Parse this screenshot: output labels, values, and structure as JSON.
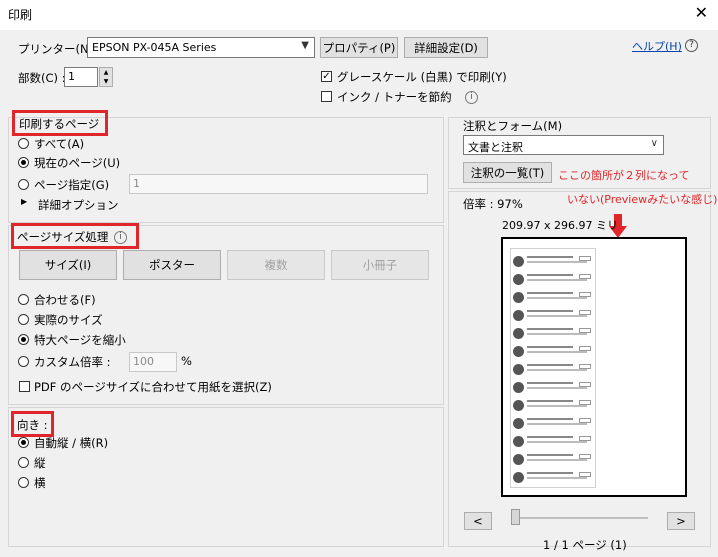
{
  "window": {
    "title": "印刷",
    "close_glyph": "✕"
  },
  "printer": {
    "label": "プリンター(N) :",
    "selected": "EPSON PX-045A Series",
    "properties_button": "プロパティ(P)",
    "advanced_button": "詳細設定(D)",
    "help_link": "ヘルプ(H)"
  },
  "copies": {
    "label": "部数(C) :",
    "value": "1"
  },
  "options": {
    "grayscale": "グレースケール (白黒) で印刷(Y)",
    "save_ink": "インク / トナーを節約"
  },
  "pages_section": {
    "title": "印刷するページ",
    "all": "すべて(A)",
    "current": "現在のページ(U)",
    "range": "ページ指定(G)",
    "range_value": "1",
    "more_options": "詳細オプション"
  },
  "size_section": {
    "title": "ページサイズ処理",
    "tabs": [
      "サイズ(I)",
      "ポスター",
      "複数",
      "小冊子"
    ],
    "fit": "合わせる(F)",
    "actual": "実際のサイズ",
    "shrink": "特大ページを縮小",
    "custom": "カスタム倍率 :",
    "custom_value": "100",
    "percent": "%",
    "pdf_paper": "PDF のページサイズに合わせて用紙を選択(Z)"
  },
  "orientation_section": {
    "title": "向き :",
    "auto": "自動縦 / 横(R)",
    "portrait": "縦",
    "landscape": "横"
  },
  "comments": {
    "label": "注釈とフォーム(M)",
    "selected": "文書と注釈",
    "summary_button": "注釈の一覧(T)"
  },
  "preview": {
    "scale": "倍率 :  97%",
    "dimensions": "209.97 x 296.97 ミリ",
    "prev_button": "<",
    "next_button": ">",
    "page_counter": "1 / 1 ページ (1)"
  },
  "annotation": {
    "line1": "ここの箇所が２列になって",
    "line2": "いない(Previewみたいな感じ)"
  }
}
